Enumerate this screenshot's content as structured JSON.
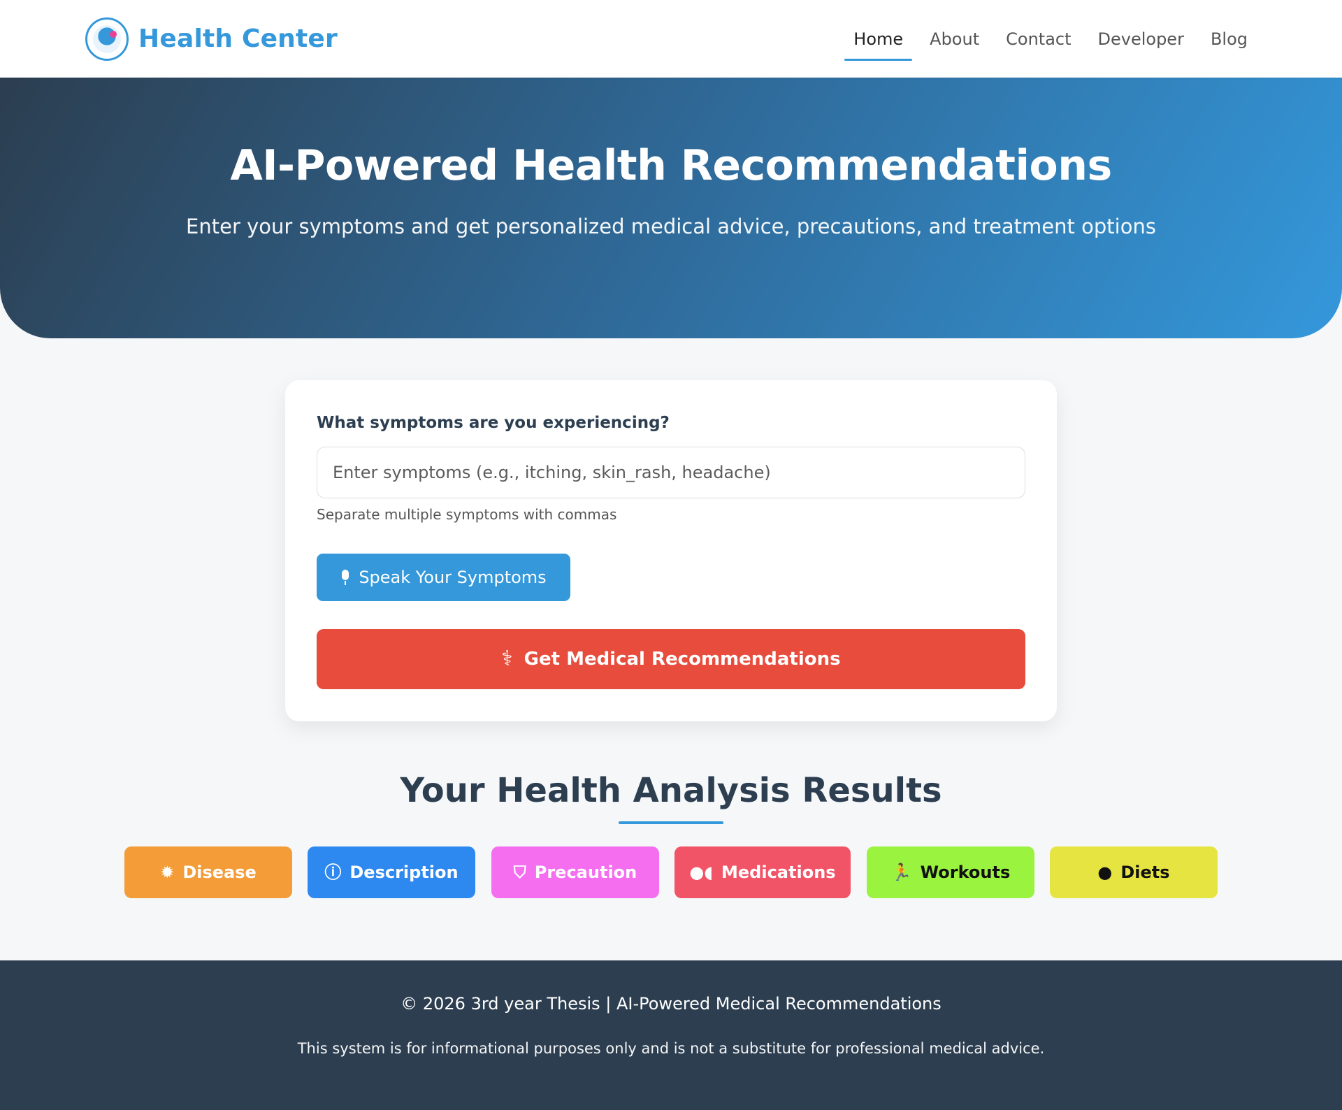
{
  "header": {
    "brand": "Health Center",
    "nav": [
      {
        "label": "Home",
        "active": true
      },
      {
        "label": "About"
      },
      {
        "label": "Contact"
      },
      {
        "label": "Developer"
      },
      {
        "label": "Blog"
      }
    ]
  },
  "hero": {
    "title": "AI-Powered Health Recommendations",
    "subtitle": "Enter your symptoms and get personalized medical advice, precautions, and treatment options"
  },
  "form": {
    "label": "What symptoms are you experiencing?",
    "input_value": "",
    "input_placeholder": "Enter symptoms (e.g., itching, skin_rash, headache)",
    "hint": "Separate multiple symptoms with commas",
    "speak_label": "Speak Your Symptoms",
    "submit_label": "Get Medical Recommendations"
  },
  "results": {
    "title": "Your Health Analysis Results",
    "tabs": [
      {
        "label": "Disease",
        "icon": "virus-icon",
        "color": "#f39c38"
      },
      {
        "label": "Description",
        "icon": "info-icon",
        "color": "#2d89ef"
      },
      {
        "label": "Precaution",
        "icon": "shield-icon",
        "color": "#f56ef0"
      },
      {
        "label": "Medications",
        "icon": "pills-icon",
        "color": "#f25467"
      },
      {
        "label": "Workouts",
        "icon": "running-icon",
        "color": "#99f33f"
      },
      {
        "label": "Diets",
        "icon": "apple-icon",
        "color": "#e6e441"
      }
    ]
  },
  "footer": {
    "copyright": "© 2026 3rd year Thesis | AI-Powered Medical Recommendations",
    "disclaimer": "This system is for informational purposes only and is not a substitute for professional medical advice."
  },
  "colors": {
    "primary": "#3498db",
    "dark": "#2c3e50",
    "danger": "#e74c3c"
  }
}
